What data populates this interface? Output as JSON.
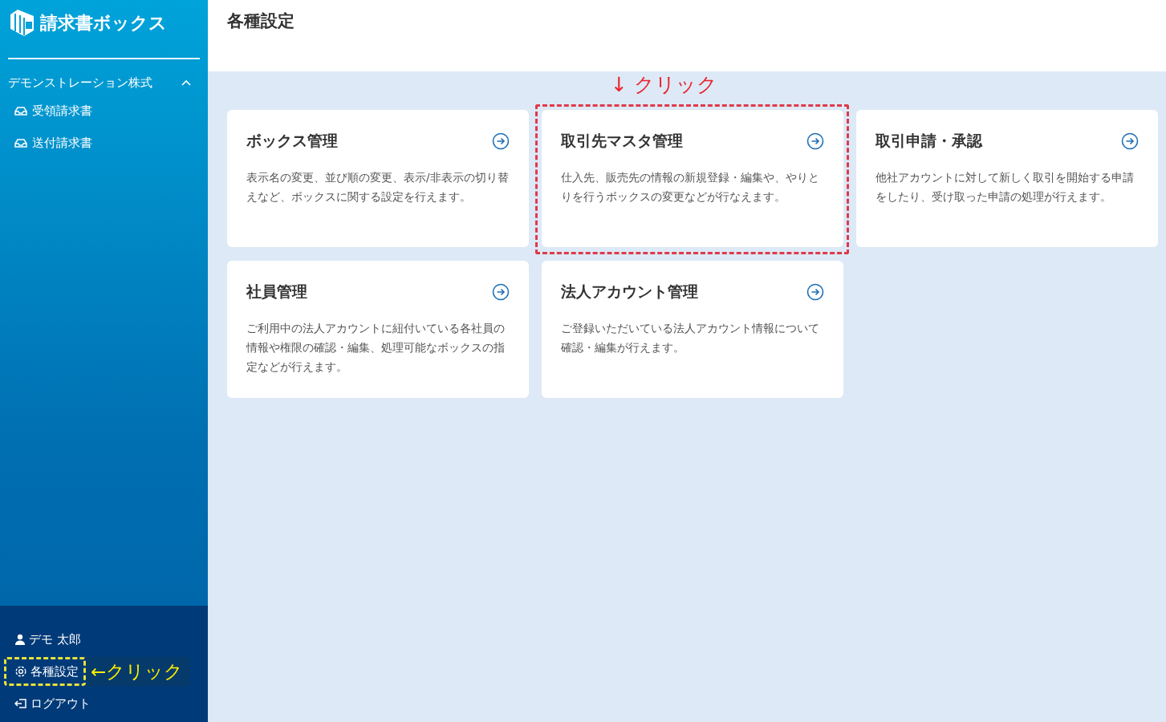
{
  "sidebar": {
    "logo": "請求書ボックス",
    "company": {
      "name": "デモンストレーション株式",
      "expanded": true
    },
    "items": [
      {
        "label": "受領請求書"
      },
      {
        "label": "送付請求書"
      }
    ],
    "footer": [
      {
        "kind": "user",
        "label": "デモ 太郎",
        "highlighted": false
      },
      {
        "kind": "settings",
        "label": "各種設定",
        "highlighted": true,
        "note": "←クリック"
      },
      {
        "kind": "logout",
        "label": "ログアウト",
        "highlighted": false
      }
    ]
  },
  "page_title": "各種設定",
  "cards": [
    {
      "title": "ボックス管理",
      "description": "表示名の変更、並び順の変更、表示/非表示の切り替えなど、ボックスに関する設定を行えます。",
      "highlighted": false
    },
    {
      "title": "取引先マスタ管理",
      "description": "仕入先、販売先の情報の新規登録・編集や、やりとりを行うボックスの変更などが行なえます。",
      "highlighted": true,
      "note": "↓ クリック"
    },
    {
      "title": "取引申請・承認",
      "description": "他社アカウントに対して新しく取引を開始する申請をしたり、受け取った申請の処理が行えます。",
      "highlighted": false
    },
    {
      "title": "社員管理",
      "description": "ご利用中の法人アカウントに紐付いている各社員の情報や権限の確認・編集、処理可能なボックスの指定などが行えます。",
      "highlighted": false
    },
    {
      "title": "法人アカウント管理",
      "description": "ご登録いただいている法人アカウント情報について確認・編集が行えます。",
      "highlighted": false
    }
  ]
}
